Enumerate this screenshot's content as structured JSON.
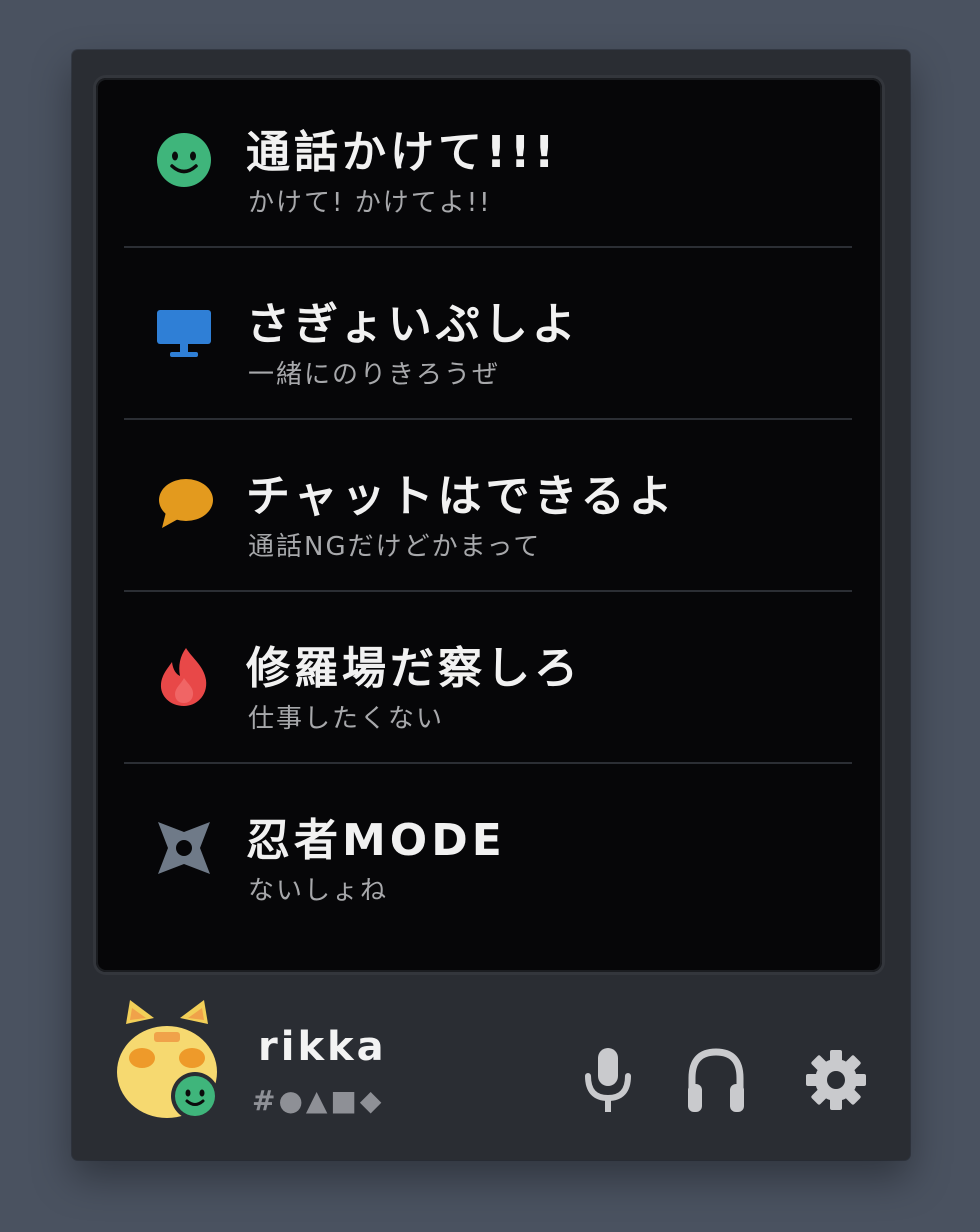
{
  "status_menu": {
    "items": [
      {
        "title": "通話かけて!!!",
        "subtitle": "かけて! かけてよ!!",
        "icon": "smile-face-icon",
        "color": "#3fb57b"
      },
      {
        "title": "さぎょいぷしよ",
        "subtitle": "一緒にのりきろうぜ",
        "icon": "monitor-icon",
        "color": "#2f7fd6"
      },
      {
        "title": "チャットはできるよ",
        "subtitle": "通話NGだけどかまって",
        "icon": "speech-bubble-icon",
        "color": "#e39a1e"
      },
      {
        "title": "修羅場だ察しろ",
        "subtitle": "仕事したくない",
        "icon": "flame-icon",
        "color": "#e84848"
      },
      {
        "title": "忍者MODE",
        "subtitle": "ないしょね",
        "icon": "shuriken-icon",
        "color": "#6f7a88"
      }
    ]
  },
  "user_panel": {
    "username": "rikka",
    "tag": "#●▲■◆",
    "status_color": "#3fb57b",
    "controls": [
      "microphone-icon",
      "headphones-icon",
      "settings-gear-icon"
    ]
  }
}
